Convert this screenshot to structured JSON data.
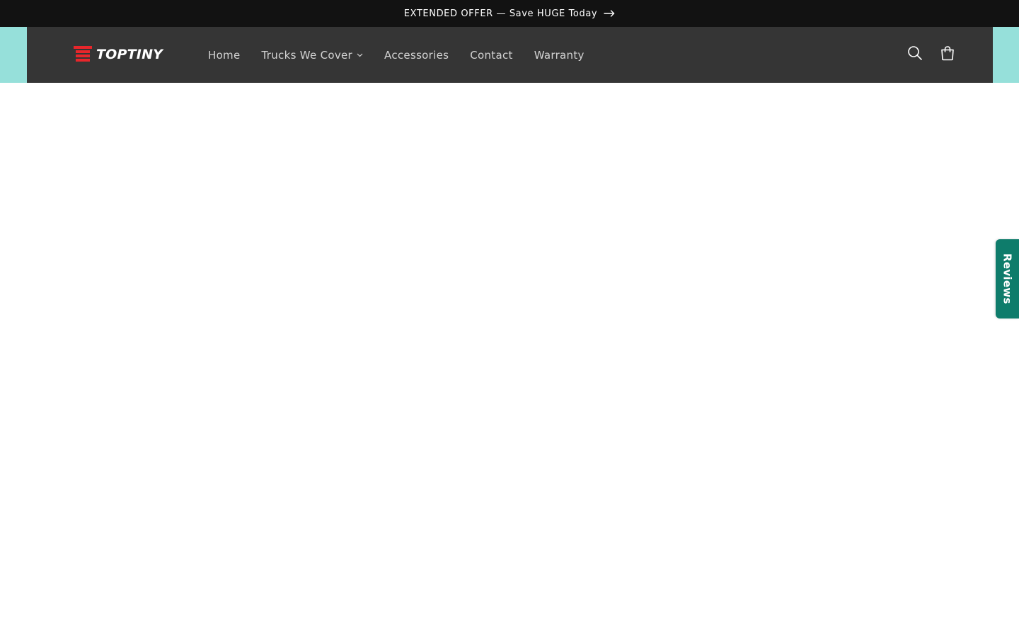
{
  "announcement": {
    "text": "EXTENDED OFFER — Save HUGE Today",
    "icon": "arrow-right-icon"
  },
  "header": {
    "logo_text": "TOPTINY",
    "logo_color": "#e8262b",
    "background": "#353535",
    "band_color": "#96e0da",
    "nav": [
      {
        "label": "Home"
      },
      {
        "label": "Trucks We Cover",
        "has_dropdown": true,
        "icon": "chevron-down-icon"
      },
      {
        "label": "Accessories"
      },
      {
        "label": "Contact"
      },
      {
        "label": "Warranty"
      }
    ],
    "actions": [
      {
        "icon": "search-icon"
      },
      {
        "icon": "cart-icon"
      }
    ]
  },
  "reviews_tab": {
    "label": "Reviews",
    "color": "#0e7c6b"
  }
}
